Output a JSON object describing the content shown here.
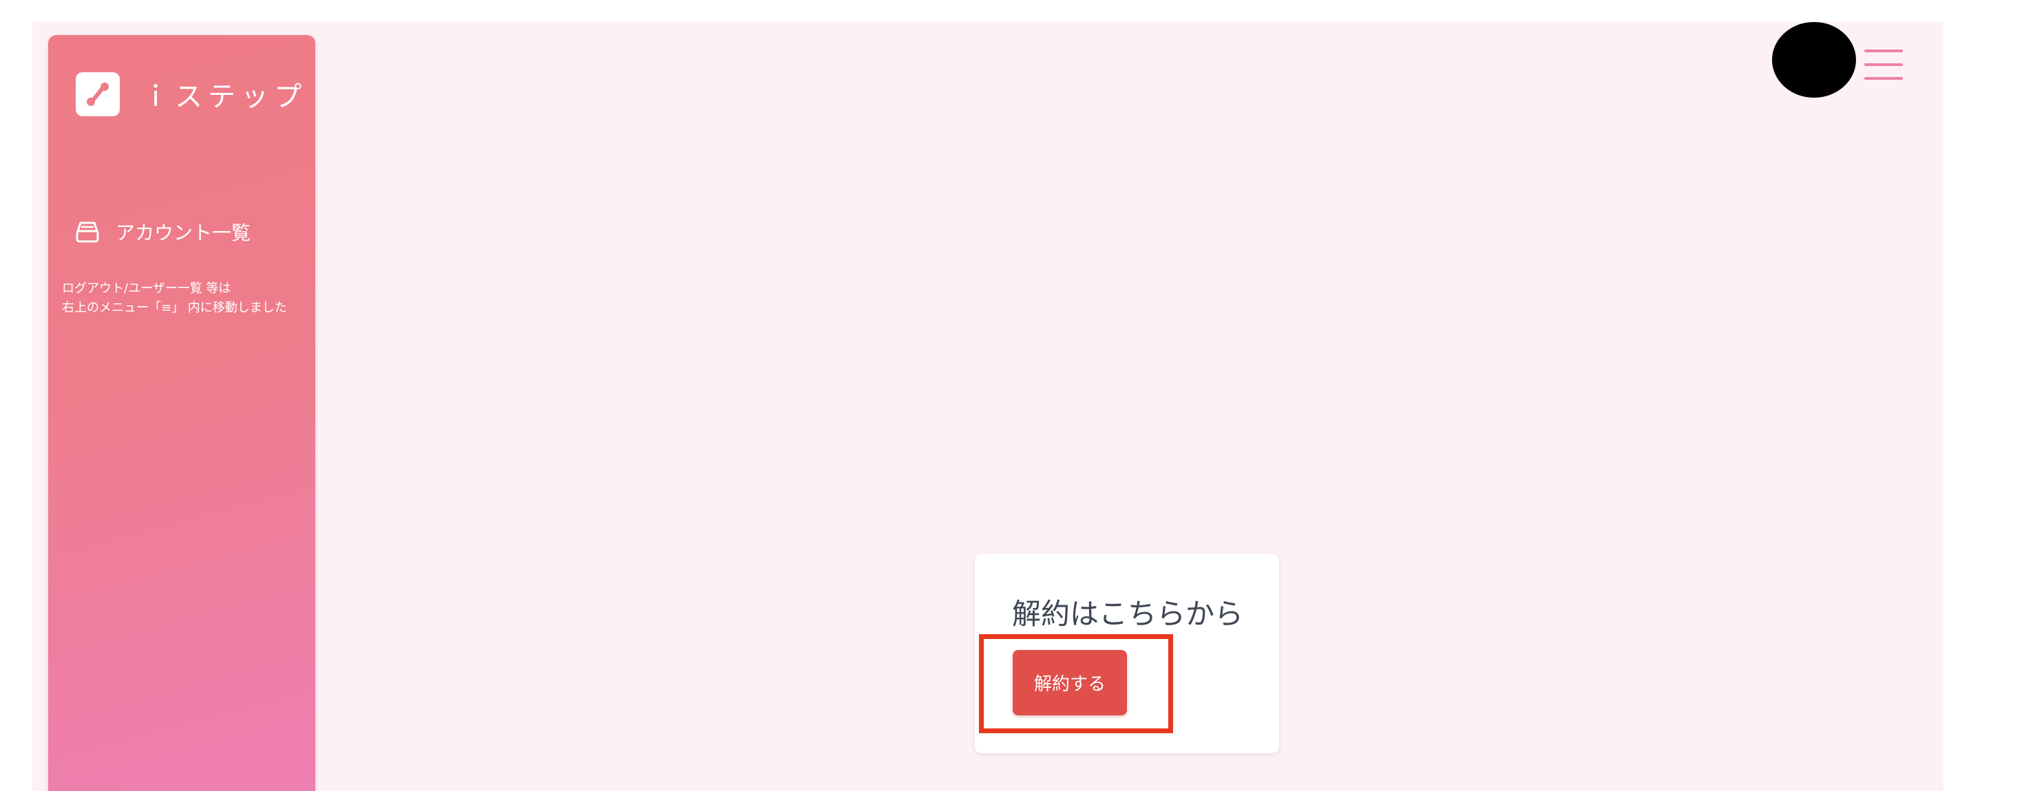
{
  "brand": {
    "name": "ｉステップ",
    "logo_icon": "link-nodes-icon"
  },
  "sidebar": {
    "items": [
      {
        "label": "アカウント一覧",
        "icon": "inbox-tray-icon"
      }
    ],
    "note_line1": "ログアウト/ユーザー一覧 等は",
    "note_line2": "右上のメニュー「≡」 内に移動しました"
  },
  "header": {
    "avatar": "avatar",
    "menu_icon": "hamburger-menu-icon"
  },
  "cancel_card": {
    "title": "解約はこちらから",
    "button_label": "解約する"
  },
  "colors": {
    "sidebar_top": "#ee7b85",
    "sidebar_bottom": "#ee7fb2",
    "page_background": "#fdf1f5",
    "cancel_button": "#e04f4a",
    "highlight_border": "#e7381f",
    "hamburger": "#ee7fa7"
  }
}
